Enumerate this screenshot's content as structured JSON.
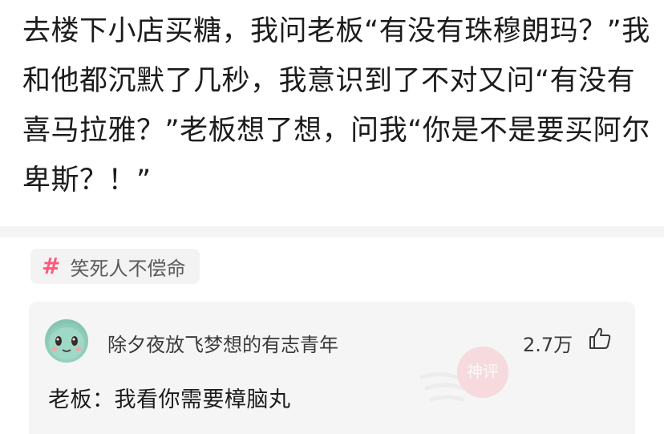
{
  "post": {
    "text": "去楼下小店买糖，我问老板“有没有珠穆朗玛？”我和他都沉默了几秒，我意识到了不对又问“有没有喜马拉雅？”老板想了想，问我“你是不是要买阿尔卑斯？！”"
  },
  "topic": {
    "label": "笑死人不偿命",
    "icon": "hash-icon",
    "accent_color": "#ff5a7d"
  },
  "comment": {
    "username": "除夕夜放飞梦想的有志青年",
    "likes": "2.7万",
    "like_icon": "thumbs-up-icon",
    "text": "老板：我看你需要樟脑丸",
    "badge_text": "神评"
  }
}
